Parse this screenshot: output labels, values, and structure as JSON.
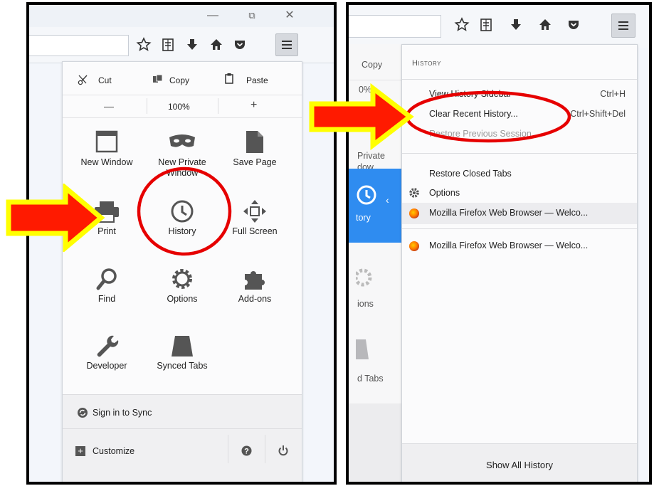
{
  "left_window": {
    "window_controls": {
      "minimize": "—",
      "restore": "⧉",
      "close": "✕"
    },
    "menu": {
      "edit_row": {
        "cut": "Cut",
        "copy": "Copy",
        "paste": "Paste"
      },
      "zoom_row": {
        "minus": "—",
        "level": "100%",
        "plus": "+"
      },
      "grid_items": [
        {
          "id": "new-window",
          "label": "New Window"
        },
        {
          "id": "new-private-window",
          "label": "New Private Window"
        },
        {
          "id": "save-page",
          "label": "Save Page"
        },
        {
          "id": "print",
          "label": "Print"
        },
        {
          "id": "history",
          "label": "History"
        },
        {
          "id": "full-screen",
          "label": "Full Screen"
        },
        {
          "id": "find",
          "label": "Find"
        },
        {
          "id": "options",
          "label": "Options"
        },
        {
          "id": "add-ons",
          "label": "Add-ons"
        },
        {
          "id": "developer",
          "label": "Developer"
        },
        {
          "id": "synced-tabs",
          "label": "Synced Tabs"
        }
      ],
      "sign_in": "Sign in to Sync",
      "customize": "Customize"
    }
  },
  "right_window": {
    "background_menu": {
      "copy": "Copy",
      "zoom": "0%",
      "private": "Private",
      "window": "dow",
      "history": "tory",
      "options": "ions",
      "synced": "d Tabs"
    },
    "history_panel": {
      "heading": "History",
      "items": [
        {
          "label": "View History Sidebar",
          "shortcut": "Ctrl+H"
        },
        {
          "label": "Clear Recent History...",
          "shortcut": "Ctrl+Shift+Del"
        },
        {
          "label": "Restore Previous Session",
          "shortcut": ""
        }
      ],
      "restore_closed_tabs": "Restore Closed Tabs",
      "options": "Options",
      "tab_entry": "Mozilla Firefox Web Browser — Welco...",
      "history_entry": "Mozilla Firefox Web Browser — Welco...",
      "show_all": "Show All History"
    }
  },
  "colors": {
    "arrow_fill": "#ff1a00",
    "arrow_outline": "#ffff00",
    "circle": "#e60000",
    "history_highlight": "#2f8cf0"
  }
}
